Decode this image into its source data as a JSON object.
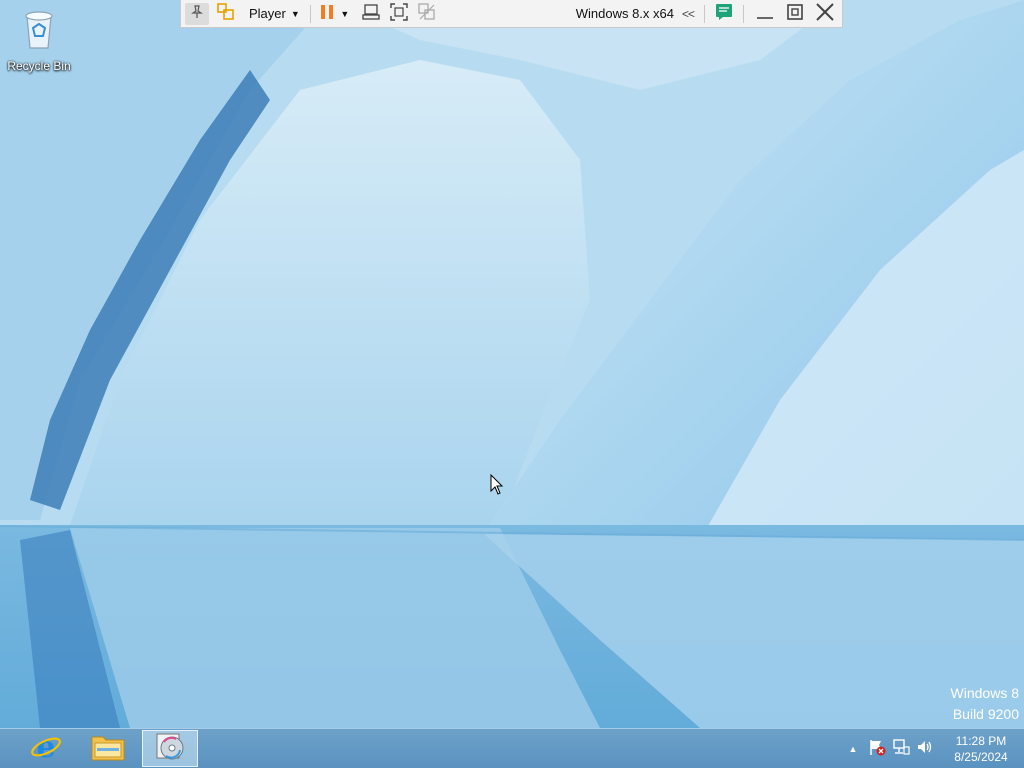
{
  "desktop": {
    "icons": [
      {
        "label": "Recycle Bin",
        "icon": "recycle-bin-icon"
      }
    ]
  },
  "vmware_toolbar": {
    "player_menu_label": "Player",
    "vm_name": "Windows 8.x x64",
    "collapse_glyph": "<<",
    "icons": [
      "pin-icon",
      "unity-icon",
      "pause-icon",
      "send-ctrl-alt-del-icon",
      "fullscreen-icon",
      "unity-exit-icon",
      "message-log-icon",
      "minimize-icon",
      "restore-icon",
      "close-icon"
    ]
  },
  "watermark": {
    "line1": "Windows 8",
    "line2": "Build 9200"
  },
  "taskbar": {
    "pinned": [
      {
        "name": "Internet Explorer",
        "icon": "internet-explorer-icon"
      },
      {
        "name": "File Explorer",
        "icon": "file-explorer-icon"
      },
      {
        "name": "Program Compatibility / Disc app",
        "icon": "disc-app-icon",
        "active": true
      }
    ],
    "tray": {
      "icons": [
        "show-hidden-icons-chevron",
        "action-center-flag-icon",
        "network-icon",
        "volume-icon"
      ],
      "time": "11:28 PM",
      "date": "8/25/2024"
    }
  },
  "colors": {
    "taskbar": "#6aa0c8",
    "toolbar_bg": "#f3f3f3",
    "pause_orange": "#f07d20",
    "accent_green": "#1fa37a"
  }
}
